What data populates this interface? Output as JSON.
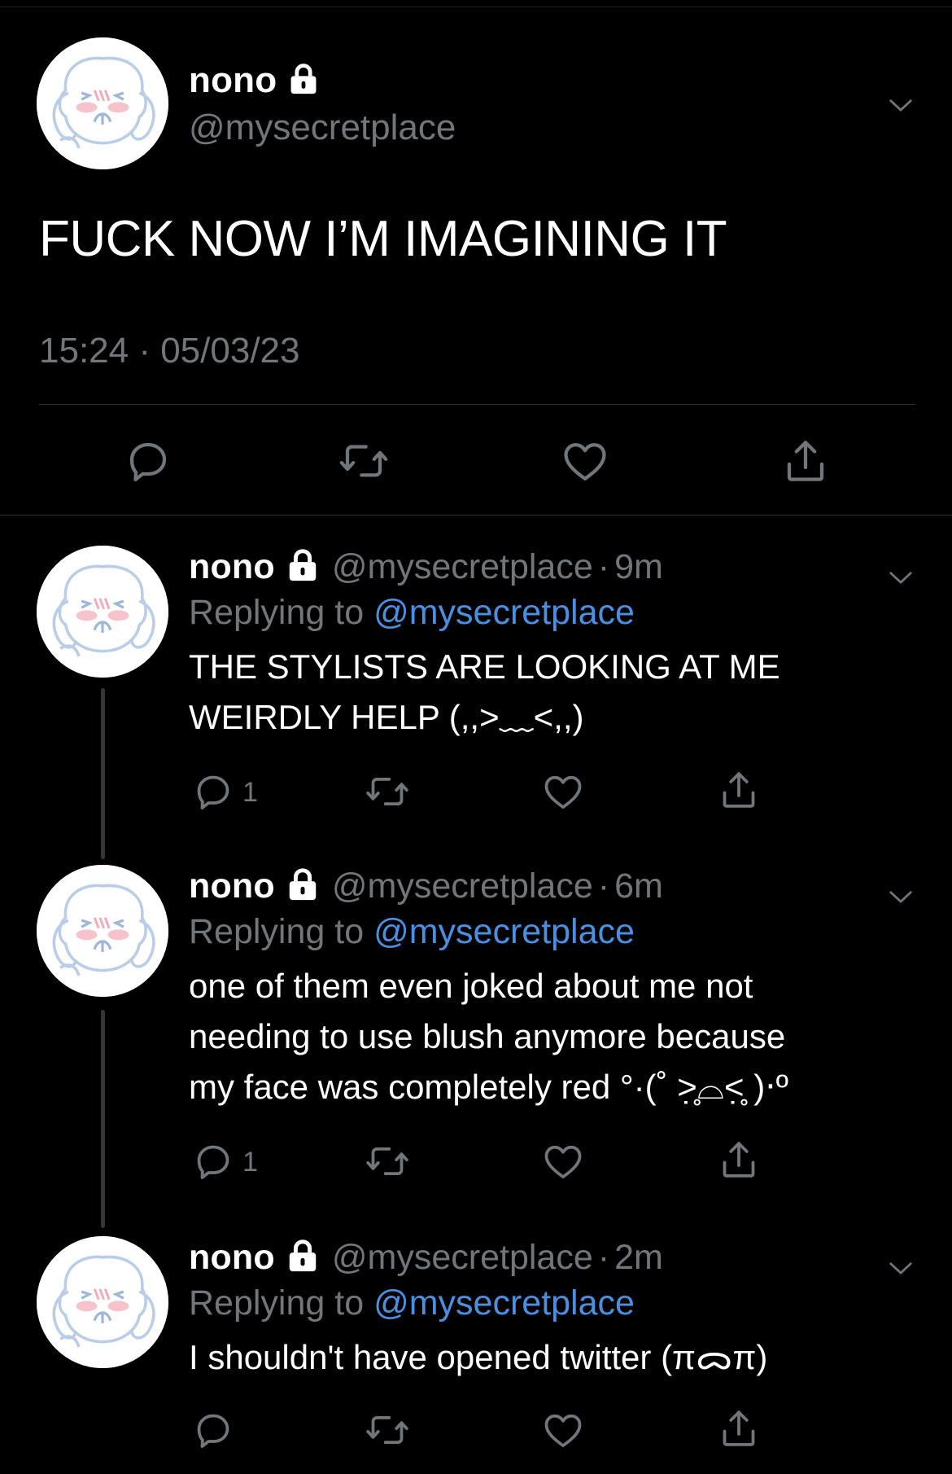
{
  "main": {
    "display_name": "nono",
    "handle": "@mysecretplace",
    "text": "FUCK NOW I’M IMAGINING IT",
    "timestamp": "15:24 · 05/03/23"
  },
  "replies": [
    {
      "display_name": "nono",
      "handle": "@mysecretplace",
      "separator": "·",
      "time": "9m",
      "replying_prefix": "Replying to ",
      "replying_to": "@mysecretplace",
      "text_lines": [
        "THE STYLISTS ARE LOOKING AT ME",
        "WEIRDLY HELP (,,>﹏<,,)"
      ],
      "reply_count": "1"
    },
    {
      "display_name": "nono",
      "handle": "@mysecretplace",
      "separator": "·",
      "time": "6m",
      "replying_prefix": "Replying to ",
      "replying_to": "@mysecretplace",
      "text_lines": [
        "one of them even joked about me not",
        "needing to use blush anymore because",
        "my face was completely red °·(˚ ˃̣̣̥⌓˂̣̣̥ )‧º"
      ],
      "reply_count": "1"
    },
    {
      "display_name": "nono",
      "handle": "@mysecretplace",
      "separator": "·",
      "time": "2m",
      "replying_prefix": "Replying to ",
      "replying_to": "@mysecretplace",
      "text_lines": [
        "I shouldn't have opened twitter (πᯅπ)"
      ],
      "reply_count": ""
    }
  ],
  "icons": {
    "reply": "speech-bubble-icon",
    "retweet": "retweet-icon",
    "like": "heart-icon",
    "share": "share-icon",
    "lock": "lock-icon",
    "more": "chevron-down-icon"
  },
  "colors": {
    "background": "#000000",
    "text": "#ffffff",
    "secondary": "#71767b",
    "link": "#4a90e2",
    "divider": "#2f3336"
  }
}
